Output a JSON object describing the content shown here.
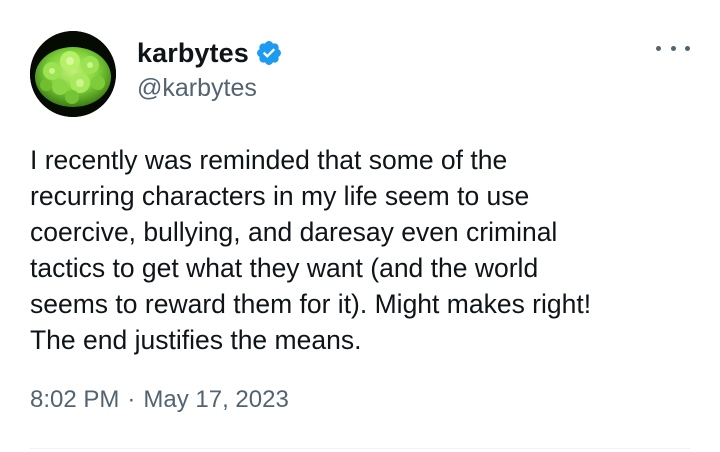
{
  "author": {
    "display_name": "karbytes",
    "handle": "@karbytes",
    "verified": true,
    "avatar_icon": "romanesco-broccoli-avatar"
  },
  "tweet": {
    "text": "I recently was reminded that some of the\nrecurring characters in my life seem to use\ncoercive, bullying, and daresay even criminal\ntactics to get what they want (and the world\nseems to reward them for it). Might makes right!\nThe end justifies the means.",
    "time": "8:02 PM",
    "separator": "·",
    "date": "May 17, 2023"
  },
  "icons": {
    "verified": "verified-badge-icon",
    "more": "more-options-icon"
  },
  "colors": {
    "primary_text": "#0f1419",
    "secondary_text": "#536471",
    "verified_blue": "#1d9bf0",
    "divider": "#eff3f4"
  }
}
